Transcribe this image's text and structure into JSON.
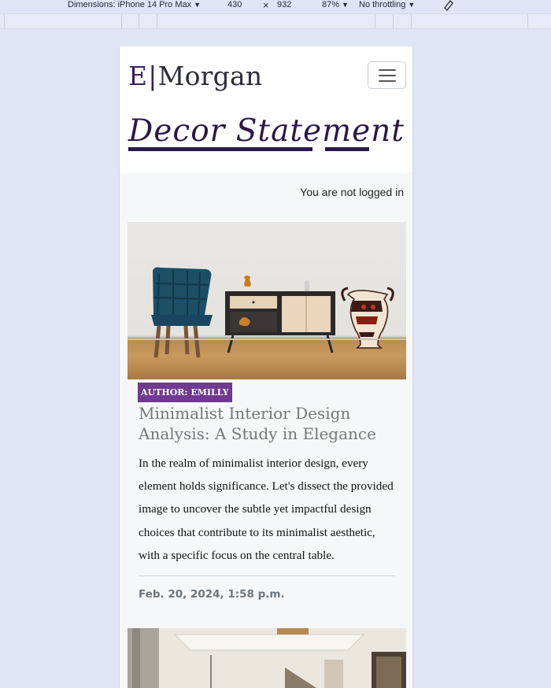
{
  "devtools": {
    "dimensions_label": "Dimensions: iPhone 14 Pro Max",
    "width": "430",
    "times": "×",
    "height": "932",
    "zoom": "87%",
    "throttling": "No throttling",
    "caret": "▼"
  },
  "navbar": {
    "brand_initial": "E",
    "brand_separator": "|",
    "brand_name": "Morgan",
    "toggler_icon": "hamburger-menu-icon"
  },
  "site_title": "Decor Statement",
  "auth": {
    "status_text": "You are not logged in"
  },
  "posts": [
    {
      "image": "minimalist-room-photo",
      "author_badge": "AUTHOR: EMILLY",
      "title": "Minimalist Interior Design Analysis: A Study in Elegance",
      "excerpt": "In the realm of minimalist interior design, every element holds significance. Let's dissect the provided image to uncover the subtle yet impactful design choices that contribute to its minimalist aesthetic, with a specific focus on the central table.",
      "date": "Feb. 20, 2024, 1:58 p.m."
    },
    {
      "image": "luxury-interior-photo"
    }
  ],
  "colors": {
    "brand_purple": "#3b1e63",
    "badge_purple": "#6f3a8f",
    "page_bg": "#dfe5f4",
    "content_bg": "#f6f7f9"
  }
}
